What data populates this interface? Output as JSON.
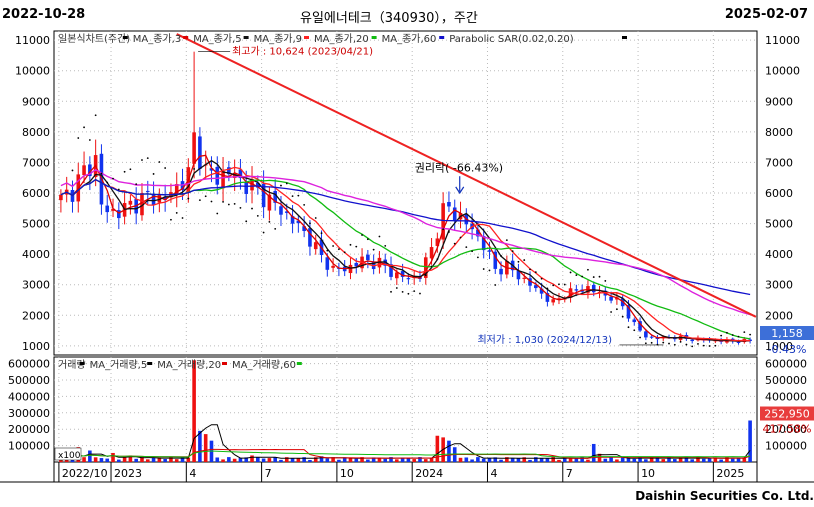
{
  "header": {
    "start_date": "2022-10-28",
    "title": "유일에너테크（340930），주간",
    "end_date": "2025-02-07"
  },
  "legend_price": [
    "일본식차트(주간)",
    "MA_종가,3",
    "MA_종가,5",
    "MA_종가,9",
    "MA_종가,20",
    "MA_종가,60",
    "Parabolic SAR(0.02,0.20)"
  ],
  "legend_volume": [
    "거래량",
    "MA_거래량,5",
    "MA_거래량,20",
    "MA_거래량,60"
  ],
  "annotations": {
    "high": "최고가 : 10,624 (2023/04/21)",
    "low": "최저가 : 1,030 (2024/12/13)",
    "rights": "권리락( -66.43%)",
    "last_price": "1,158",
    "last_change": "-0.43%",
    "last_volume": "252,950",
    "volume_change": "417.58%",
    "volume_scale": "x100"
  },
  "footer": "Daishin Securities Co. Ltd.",
  "colors": {
    "up": "#ee1111",
    "down": "#1133ee",
    "ma3": "#dd0000",
    "ma5": "#111111",
    "ma9": "#ff2222",
    "ma20": "#11bb11",
    "ma60": "#1111cc",
    "ma120": "#dd22dd",
    "trend": "#ee2222",
    "badge_blue": "#3d6fd8",
    "badge_red": "#e83c3c"
  },
  "chart_data": [
    {
      "type": "candlestick",
      "title": "유일에너테크（340930），주간",
      "period": [
        "2022-10-28",
        "2025-02-07"
      ],
      "y_ticks": [
        1000,
        2000,
        3000,
        4000,
        5000,
        6000,
        7000,
        8000,
        9000,
        10000,
        11000
      ],
      "ylim": [
        700,
        11300
      ],
      "x_ticks": [
        {
          "label": "2022/10",
          "week": 0
        },
        {
          "label": "2023",
          "week": 9
        },
        {
          "label": "4",
          "week": 22
        },
        {
          "label": "7",
          "week": 35
        },
        {
          "label": "10",
          "week": 48
        },
        {
          "label": "2024",
          "week": 61
        },
        {
          "label": "4",
          "week": 74
        },
        {
          "label": "7",
          "week": 87
        },
        {
          "label": "10",
          "week": 100
        },
        {
          "label": "2025",
          "week": 113
        }
      ],
      "num_weeks": 120,
      "price_anchors": [
        [
          0,
          5800
        ],
        [
          2,
          6100
        ],
        [
          4,
          6700
        ],
        [
          6,
          7100
        ],
        [
          7,
          5600
        ],
        [
          8,
          5400
        ],
        [
          10,
          5400
        ],
        [
          12,
          5600
        ],
        [
          15,
          5900
        ],
        [
          18,
          5800
        ],
        [
          20,
          6200
        ],
        [
          22,
          6600
        ],
        [
          23,
          7800
        ],
        [
          25,
          6700
        ],
        [
          27,
          6500
        ],
        [
          29,
          6700
        ],
        [
          31,
          6400
        ],
        [
          33,
          6200
        ],
        [
          35,
          5900
        ],
        [
          37,
          5600
        ],
        [
          40,
          5100
        ],
        [
          43,
          4500
        ],
        [
          45,
          3900
        ],
        [
          47,
          3500
        ],
        [
          49,
          3500
        ],
        [
          52,
          3800
        ],
        [
          55,
          3700
        ],
        [
          58,
          3300
        ],
        [
          60,
          3200
        ],
        [
          62,
          3300
        ],
        [
          64,
          4200
        ],
        [
          66,
          5400
        ],
        [
          67,
          5500
        ],
        [
          69,
          5200
        ],
        [
          71,
          4800
        ],
        [
          73,
          4300
        ],
        [
          75,
          3500
        ],
        [
          77,
          3600
        ],
        [
          79,
          3300
        ],
        [
          81,
          3000
        ],
        [
          83,
          2700
        ],
        [
          85,
          2400
        ],
        [
          87,
          2700
        ],
        [
          89,
          2800
        ],
        [
          91,
          2900
        ],
        [
          93,
          2700
        ],
        [
          95,
          2600
        ],
        [
          97,
          2300
        ],
        [
          99,
          1700
        ],
        [
          101,
          1300
        ],
        [
          103,
          1250
        ],
        [
          106,
          1280
        ],
        [
          108,
          1230
        ],
        [
          110,
          1200
        ],
        [
          112,
          1180
        ],
        [
          114,
          1160
        ],
        [
          119,
          1158
        ]
      ],
      "highs": [
        {
          "week": 23,
          "value": 10624,
          "date": "2023/04/21"
        }
      ],
      "lows": [
        {
          "week": 103,
          "value": 1030,
          "date": "2024/12/13"
        }
      ],
      "series": [
        {
          "name": "MA_종가,3"
        },
        {
          "name": "MA_종가,5"
        },
        {
          "name": "MA_종가,9"
        },
        {
          "name": "MA_종가,20"
        },
        {
          "name": "MA_종가,60"
        },
        {
          "name": "Parabolic SAR(0.02,0.20)"
        }
      ],
      "trendline": {
        "from": [
          20,
          11200
        ],
        "to": [
          120,
          1950
        ]
      },
      "last": {
        "price": 1158,
        "change_pct": -0.43
      }
    },
    {
      "type": "bar",
      "title": "거래량",
      "y_ticks": [
        100000,
        200000,
        300000,
        400000,
        500000,
        600000
      ],
      "ylim": [
        0,
        640000
      ],
      "volume_spikes": [
        [
          3,
          90000
        ],
        [
          5,
          70000
        ],
        [
          9,
          55000
        ],
        [
          12,
          40000
        ],
        [
          23,
          620000
        ],
        [
          24,
          190000
        ],
        [
          25,
          170000
        ],
        [
          26,
          130000
        ],
        [
          33,
          40000
        ],
        [
          45,
          35000
        ],
        [
          65,
          160000
        ],
        [
          66,
          150000
        ],
        [
          67,
          130000
        ],
        [
          68,
          90000
        ],
        [
          85,
          30000
        ],
        [
          92,
          110000
        ],
        [
          93,
          50000
        ],
        [
          119,
          252950
        ]
      ],
      "series": [
        {
          "name": "거래량"
        },
        {
          "name": "MA_거래량,5"
        },
        {
          "name": "MA_거래량,20"
        },
        {
          "name": "MA_거래량,60"
        }
      ],
      "last": {
        "volume": 252950,
        "change_pct": 417.58
      }
    }
  ]
}
